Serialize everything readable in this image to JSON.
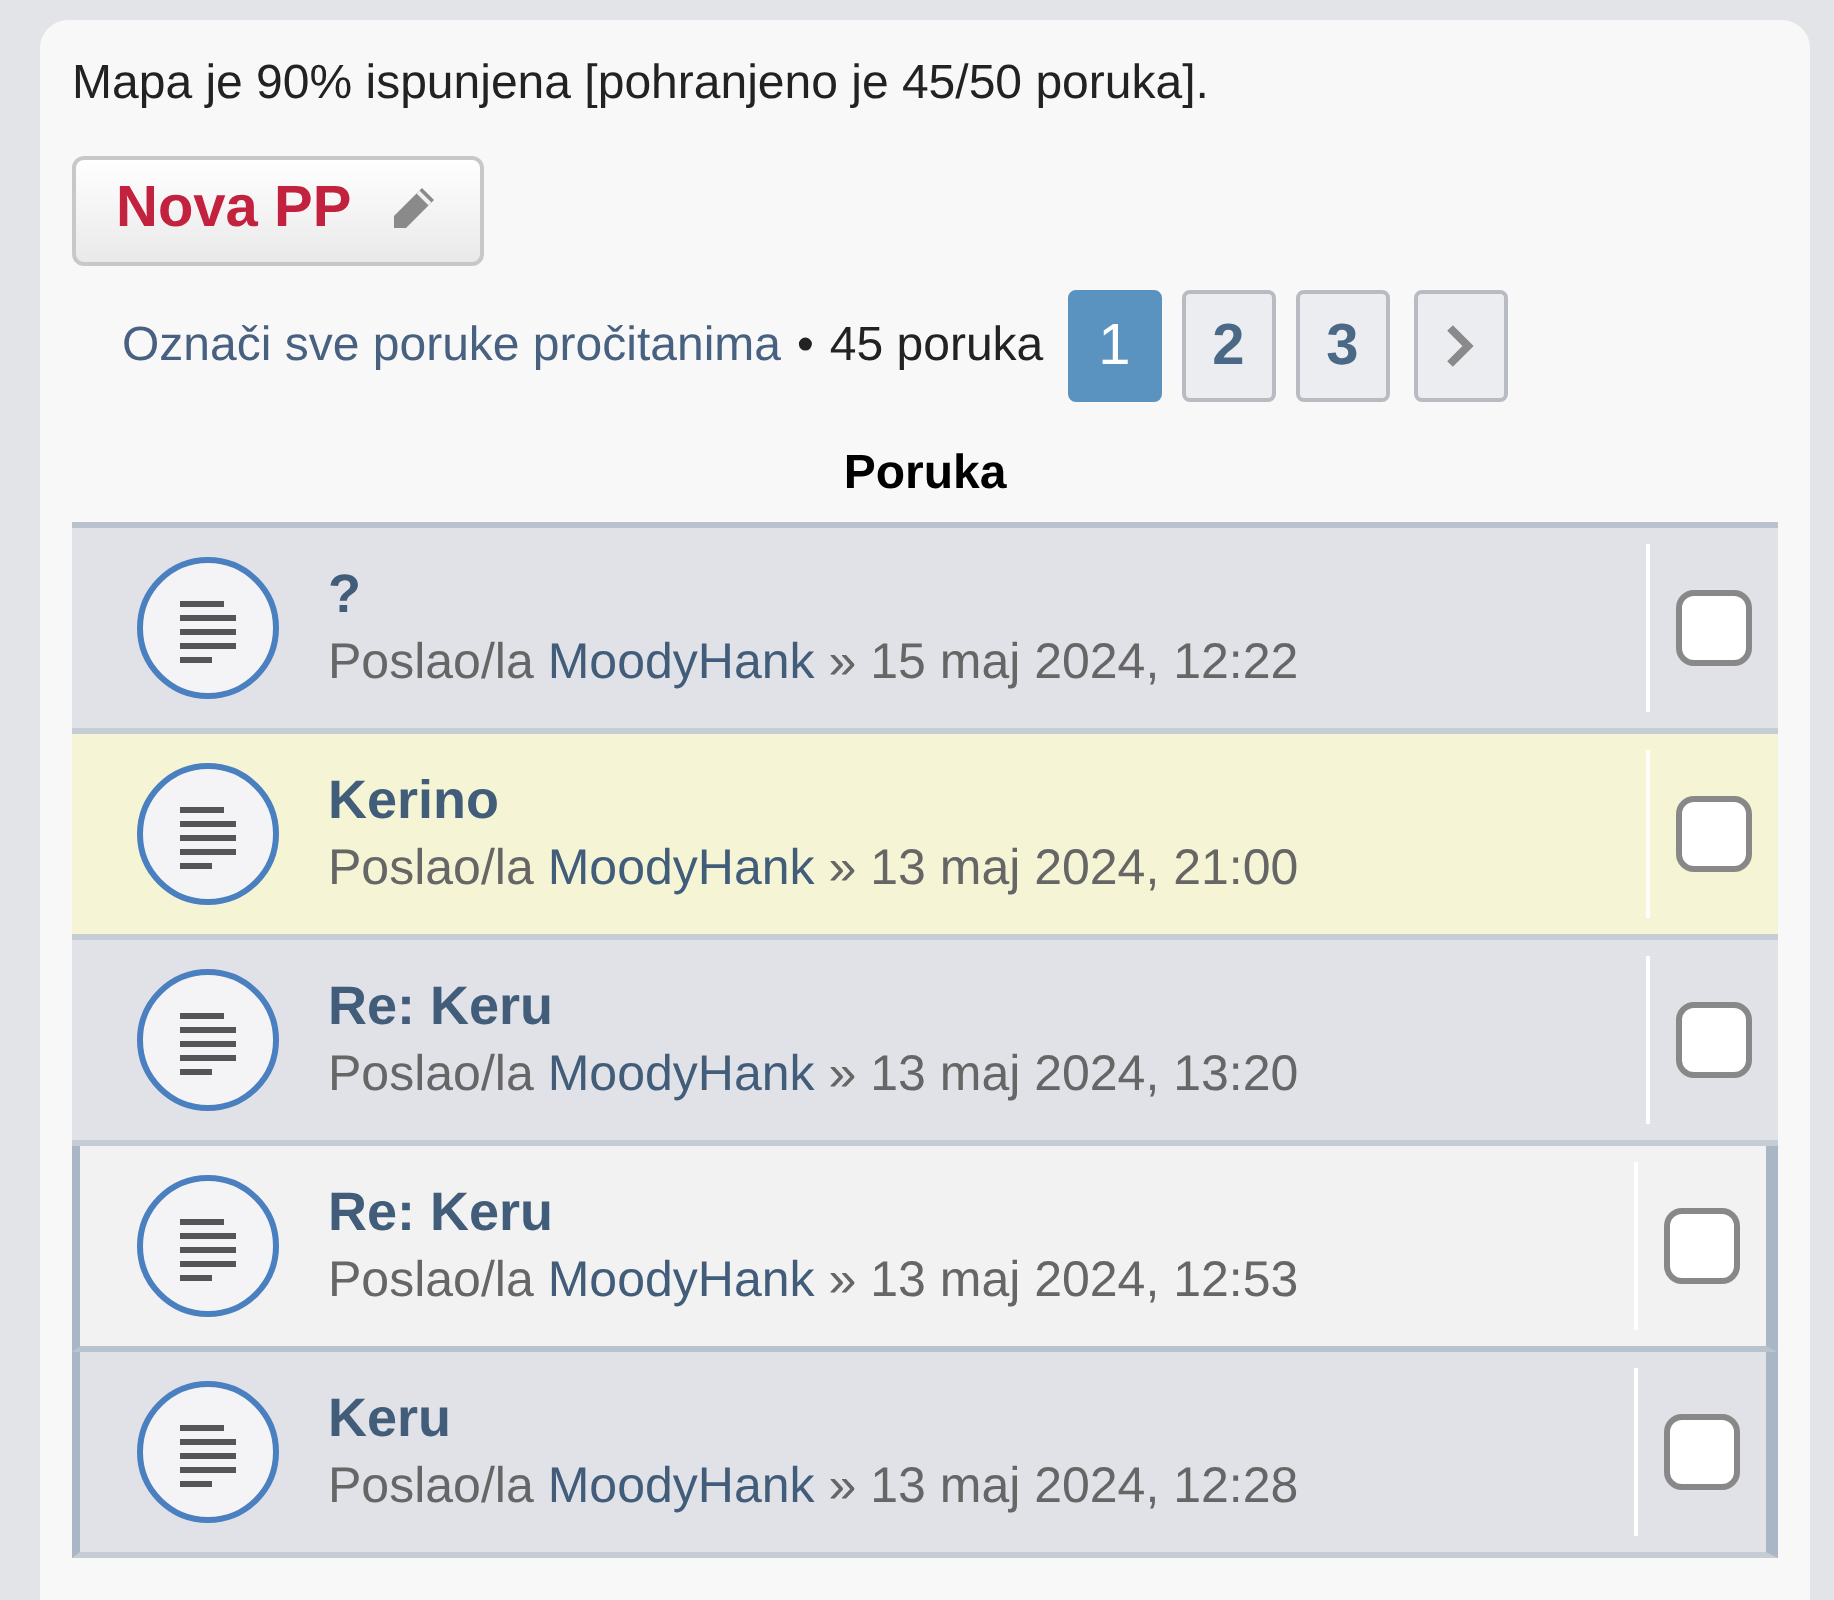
{
  "folder_status": "Mapa je 90% ispunjena [pohranjeno je 45/50 poruka].",
  "new_button": {
    "label": "Nova PP"
  },
  "mark_read_link": "Označi sve poruke pročitanima",
  "separator": "•",
  "message_count": "45 poruka",
  "pagination": [
    {
      "label": "1",
      "selected": true
    },
    {
      "label": "2",
      "selected": false
    },
    {
      "label": "3",
      "selected": false
    }
  ],
  "next_page": true,
  "table": {
    "column": "Poruka",
    "rows": [
      {
        "subject": "?",
        "by_label": "Poslao/la",
        "author": "MoodyHank",
        "date": "» 15 maj 2024, 12:22",
        "alternate": false,
        "highlighted": false,
        "marked": false,
        "checked": false
      },
      {
        "subject": "Kerino",
        "by_label": "Poslao/la",
        "author": "MoodyHank",
        "date": "» 13 maj 2024, 21:00",
        "alternate": false,
        "highlighted": true,
        "marked": false,
        "checked": false
      },
      {
        "subject": "Re: Keru",
        "by_label": "Poslao/la",
        "author": "MoodyHank",
        "date": "» 13 maj 2024, 13:20",
        "alternate": false,
        "highlighted": false,
        "marked": false,
        "checked": false
      },
      {
        "subject": "Re: Keru",
        "by_label": "Poslao/la",
        "author": "MoodyHank",
        "date": "» 13 maj 2024, 12:53",
        "alternate": true,
        "highlighted": false,
        "marked": true,
        "checked": false
      },
      {
        "subject": "Keru",
        "by_label": "Poslao/la",
        "author": "MoodyHank",
        "date": "» 13 maj 2024, 12:28",
        "alternate": false,
        "highlighted": false,
        "marked": true,
        "checked": false
      }
    ]
  }
}
